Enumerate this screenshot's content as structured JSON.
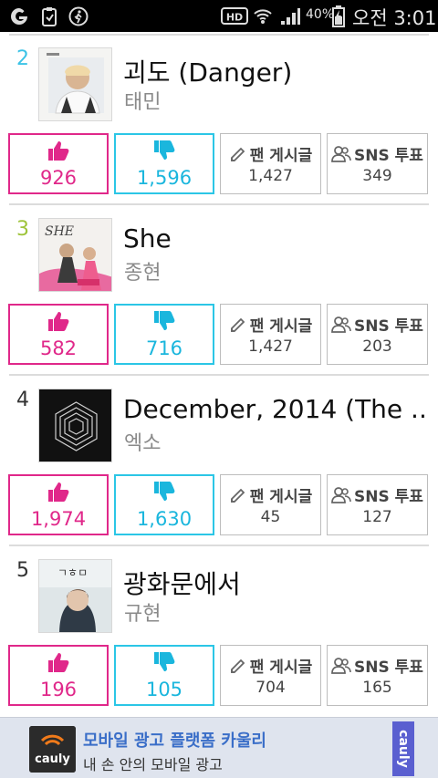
{
  "status_bar": {
    "battery": "40%",
    "time": "오전 3:01",
    "icons": [
      "g-logo-icon",
      "clipboard-icon",
      "walker-icon",
      "hd-icon",
      "wifi-icon",
      "signal-icon",
      "battery-icon"
    ]
  },
  "colors": {
    "like_accent": "#e0288a",
    "dislike_accent": "#2bc6e6",
    "rank_2": "#3cc3e6",
    "rank_3": "#9ec43a",
    "rank_default": "#333333"
  },
  "labels": {
    "fan_board": "팬 게시글",
    "sns_vote": "SNS 투표"
  },
  "songs": [
    {
      "rank": "2",
      "title": "괴도 (Danger)",
      "artist": "태민",
      "likes": "926",
      "dislikes": "1,596",
      "fan_posts": "1,427",
      "sns_votes": "349"
    },
    {
      "rank": "3",
      "title": "She",
      "artist": "종현",
      "likes": "582",
      "dislikes": "716",
      "fan_posts": "1,427",
      "sns_votes": "203"
    },
    {
      "rank": "4",
      "title": "December, 2014 (The ...",
      "artist": "엑소",
      "likes": "1,974",
      "dislikes": "1,630",
      "fan_posts": "45",
      "sns_votes": "127"
    },
    {
      "rank": "5",
      "title": "광화문에서",
      "artist": "규현",
      "likes": "196",
      "dislikes": "105",
      "fan_posts": "704",
      "sns_votes": "165"
    }
  ],
  "ad": {
    "logo_text": "cauly",
    "title": "모바일 광고 플랫폼 카울리",
    "subtitle": "내 손 안의 모바일 광고",
    "tag": "cauly"
  }
}
